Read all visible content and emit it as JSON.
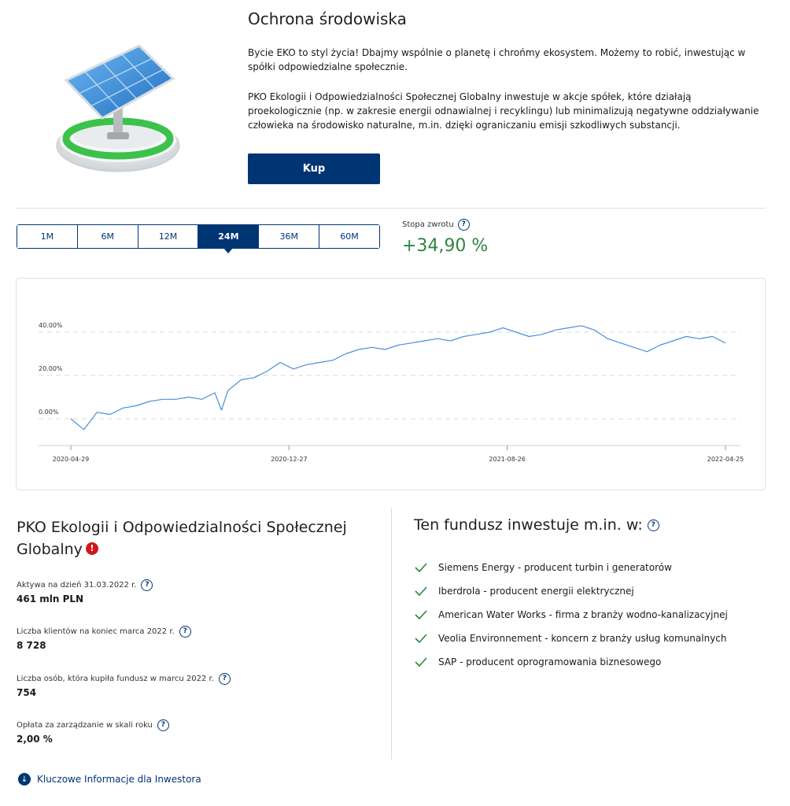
{
  "header": {
    "title": "Ochrona środowiska",
    "paragraph1": "Bycie EKO to styl życia! Dbajmy wspólnie o planetę i chrońmy ekosystem. Możemy to robić, inwestując w spółki odpowiedzialne społecznie.",
    "paragraph2": "PKO Ekologii i Odpowiedzialności Społecznej Globalny inwestuje w akcje spółek, które działają proekologicznie (np. w zakresie energii odnawialnej i recyklingu) lub minimalizują negatywne oddziaływanie człowieka na środowisko naturalne, m.in. dzięki ograniczaniu emisji szkodliwych substancji.",
    "buy_label": "Kup",
    "image_icon": "solar-panel-icon"
  },
  "periods": {
    "items": [
      "1M",
      "6M",
      "12M",
      "24M",
      "36M",
      "60M"
    ],
    "selected": "24M"
  },
  "return_rate": {
    "label": "Stopa zwrotu",
    "value": "+34,90 %",
    "color": "#2e8540"
  },
  "chart_data": {
    "type": "line",
    "x_ticks": [
      "2020-04-29",
      "2020-12-27",
      "2021-08-26",
      "2022-04-25"
    ],
    "y_ticks": [
      "0.00%",
      "20.00%",
      "40.00%"
    ],
    "ylim": [
      -10,
      50
    ],
    "grid": "horizontal-dashed",
    "line_color": "#4a90d9",
    "series": [
      {
        "x": [
          0,
          0.02,
          0.04,
          0.06,
          0.08,
          0.1,
          0.12,
          0.14,
          0.16,
          0.18,
          0.2,
          0.22,
          0.23,
          0.24,
          0.26,
          0.28,
          0.3,
          0.32,
          0.34,
          0.36,
          0.38,
          0.4,
          0.42,
          0.44,
          0.46,
          0.48,
          0.5,
          0.52,
          0.54,
          0.56,
          0.58,
          0.6,
          0.62,
          0.64,
          0.66,
          0.68,
          0.7,
          0.72,
          0.74,
          0.76,
          0.78,
          0.8,
          0.82,
          0.84,
          0.86,
          0.88,
          0.9,
          0.92,
          0.94,
          0.96,
          0.98,
          1.0
        ],
        "y": [
          0,
          -5,
          3,
          2,
          5,
          6,
          8,
          9,
          9,
          10,
          9,
          12,
          4,
          13,
          18,
          19,
          22,
          26,
          23,
          25,
          26,
          27,
          30,
          32,
          33,
          32,
          34,
          35,
          36,
          37,
          36,
          38,
          39,
          40,
          42,
          40,
          38,
          39,
          41,
          42,
          43,
          41,
          37,
          35,
          33,
          31,
          34,
          36,
          38,
          37,
          38,
          35
        ]
      }
    ]
  },
  "fund": {
    "title": "PKO Ekologii i Odpowiedzialności Społecznej Globalny",
    "warning_icon": "warning-icon",
    "stats": [
      {
        "label": "Aktywa na dzień 31.03.2022 r.",
        "value": "461 mln PLN"
      },
      {
        "label": "Liczba klientów na koniec marca 2022 r.",
        "value": "8 728"
      },
      {
        "label": "Liczba osób, która kupiła fundusz w marcu 2022 r.",
        "value": "754"
      },
      {
        "label": "Opłata za zarządzanie w skali roku",
        "value": "2,00 %"
      }
    ],
    "kid_link": "Kluczowe Informacje dla Inwestora"
  },
  "investments": {
    "title": "Ten fundusz inwestuje m.in. w:",
    "items": [
      "Siemens Energy - producent turbin i generatorów",
      "Iberdrola - producent energii elektrycznej",
      "American Water Works - firma z branży wodno-kanalizacyjnej",
      "Veolia Environnement - koncern z branży usług komunalnych",
      "SAP - producent oprogramowania biznesowego"
    ]
  }
}
